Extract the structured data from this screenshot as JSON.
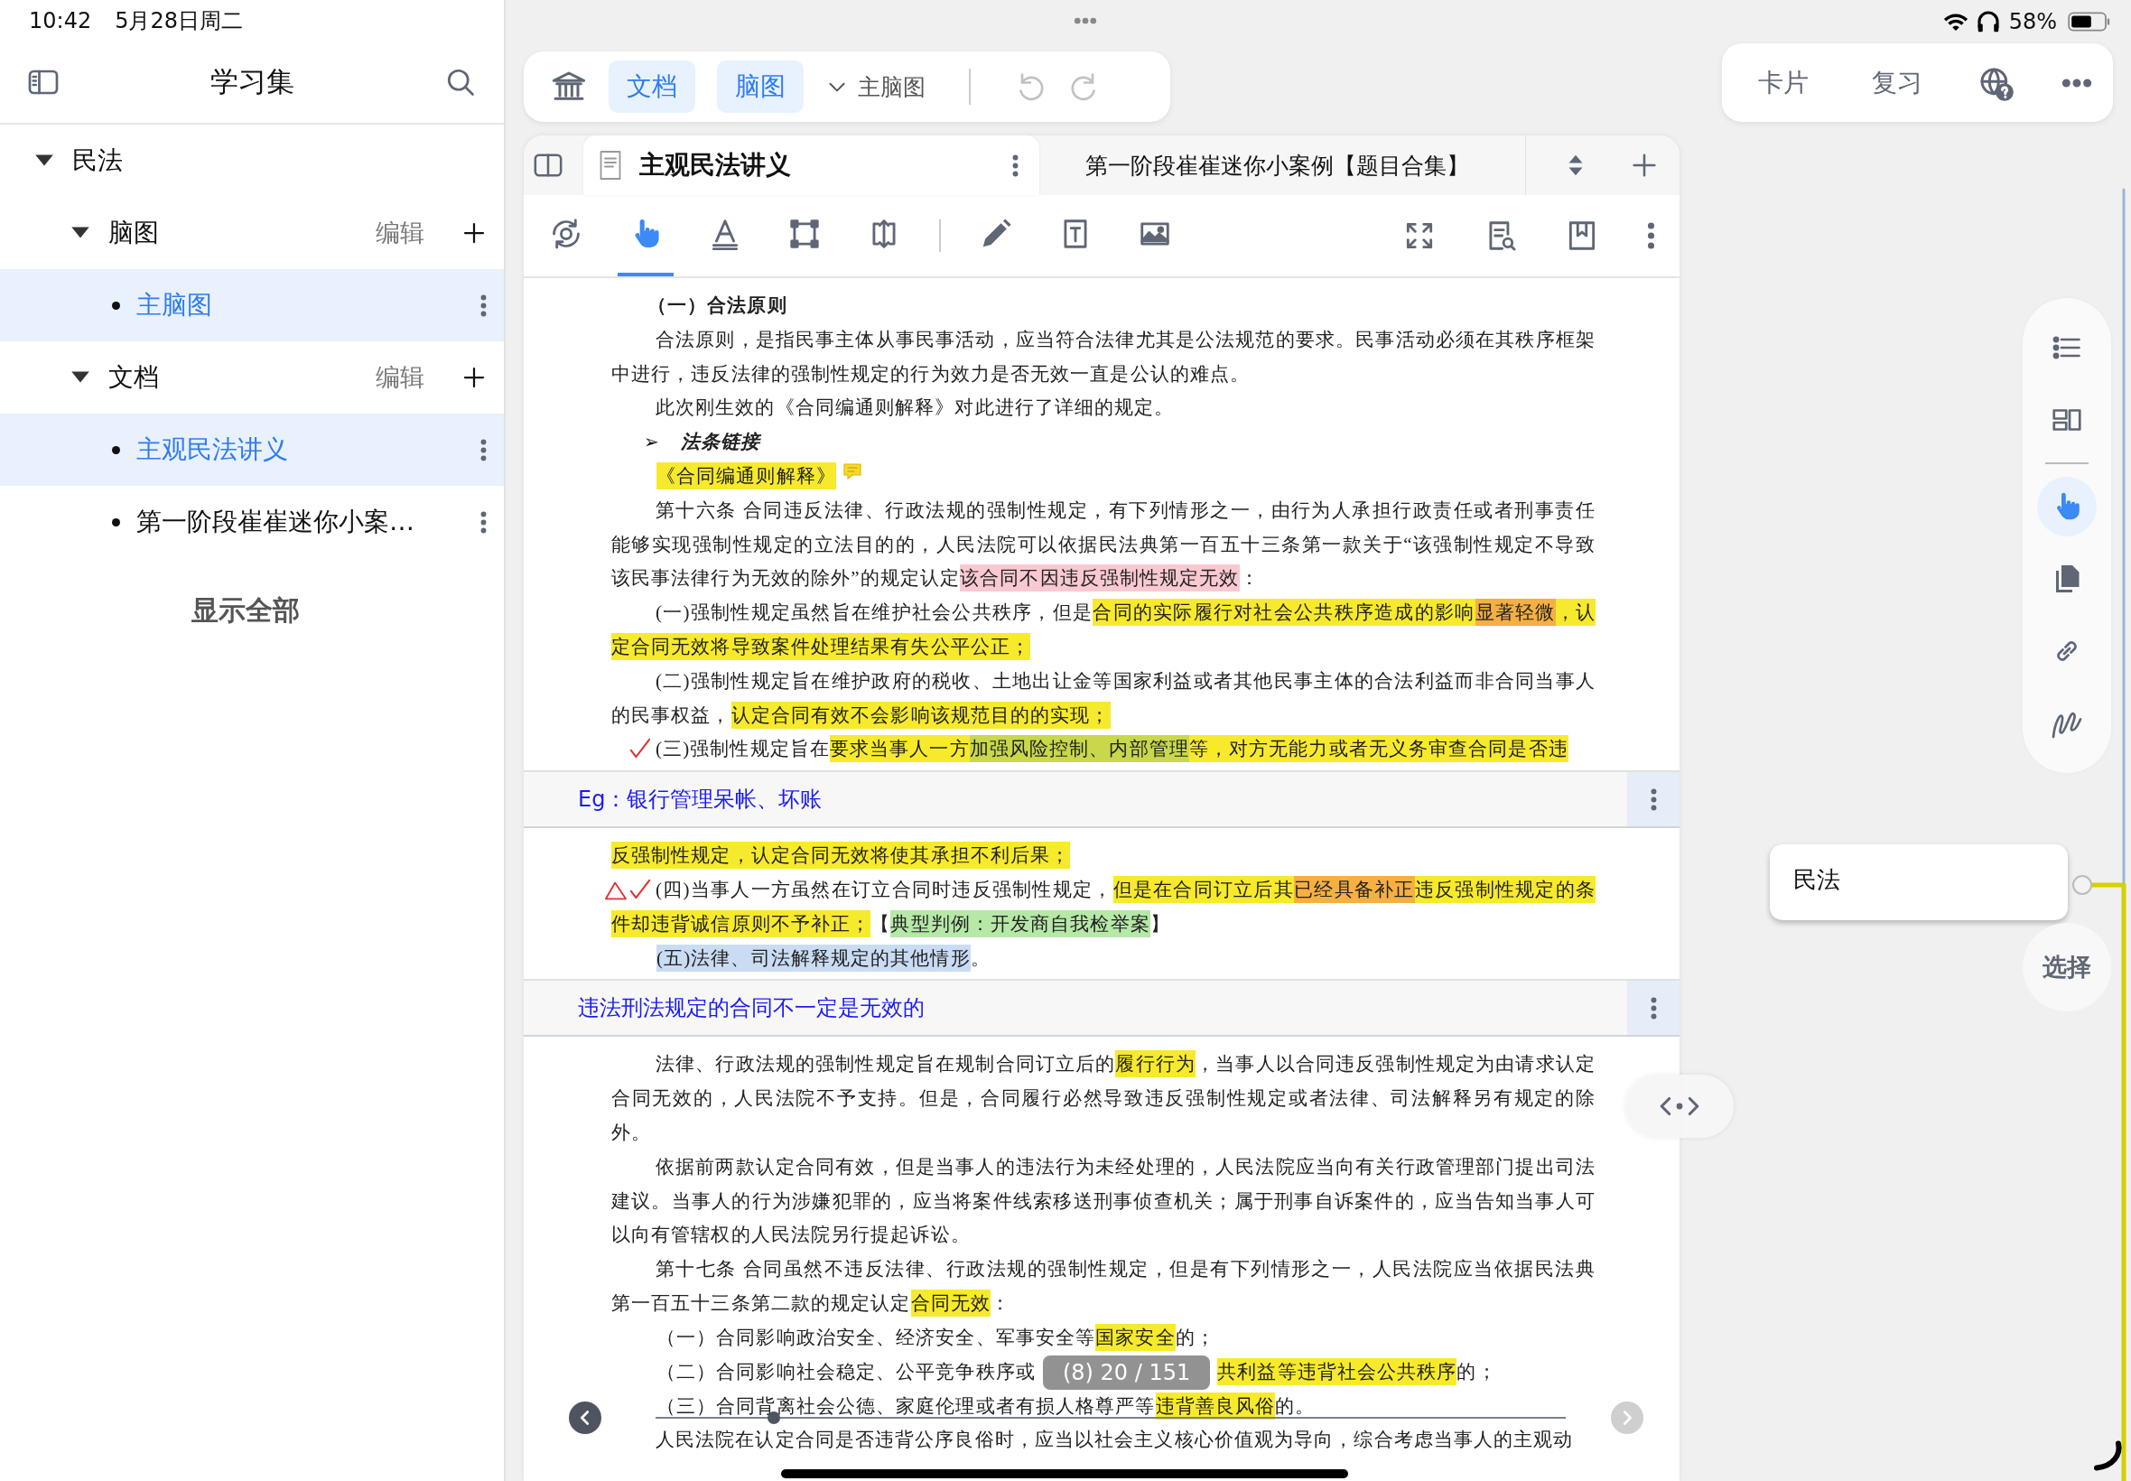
{
  "status": {
    "time": "10:42",
    "date": "5月28日周二",
    "battery": "58%"
  },
  "sidebar": {
    "title": "学习集",
    "tree": [
      {
        "label": "民法",
        "expanded": true,
        "children": [
          {
            "label": "脑图",
            "expanded": true,
            "action": "编辑",
            "children": [
              {
                "label": "主脑图",
                "selected": true
              }
            ]
          },
          {
            "label": "文档",
            "expanded": true,
            "action": "编辑",
            "children": [
              {
                "label": "主观民法讲义",
                "selected": true
              },
              {
                "label": "第一阶段崔崔迷你小案…",
                "selected": false
              }
            ]
          }
        ]
      }
    ],
    "show_all": "显示全部"
  },
  "toolbar": {
    "views": [
      {
        "label": "文档",
        "selected": true
      },
      {
        "label": "脑图",
        "selected": true
      }
    ],
    "map_selector": "主脑图",
    "undo_disabled": true,
    "redo_disabled": true
  },
  "right_toolbar": {
    "buttons": [
      "卡片",
      "复习"
    ]
  },
  "doc": {
    "tabs": [
      {
        "title": "主观民法讲义",
        "selected": true
      },
      {
        "title": "第一阶段崔崔迷你小案例【题目合集】",
        "selected": false
      }
    ],
    "tools": [
      {
        "kind": "gear-cycle",
        "selected": false
      },
      {
        "kind": "hand",
        "selected": true
      },
      {
        "kind": "text-style",
        "selected": false
      },
      {
        "kind": "select-rect",
        "selected": false
      },
      {
        "kind": "resize",
        "selected": false
      },
      {
        "kind": "pencil",
        "selected": false
      },
      {
        "kind": "text-box",
        "selected": false
      },
      {
        "kind": "image",
        "selected": false
      }
    ],
    "sections": [
      {
        "kind": "page",
        "paragraphs": [
          {
            "kind": "heading",
            "segs": [
              "（一）合法原则"
            ]
          },
          {
            "kind": "para",
            "segs": [
              "合法原则，是指民事主体从事民事活动，应当符合法律尤其是公法规范的要求。民事活动必须在其秩序框架中进行，违反法律的强制性规定的行为效力是否无效一直是公认的难点。"
            ]
          },
          {
            "kind": "para",
            "segs": [
              "此次刚生效的《合同编通则解释》对此进行了详细的规定。"
            ]
          },
          {
            "kind": "bullet",
            "bullet": "➢",
            "segs": [
              "法条链接"
            ]
          },
          {
            "kind": "item",
            "note": true,
            "segs": [
              {
                "text": "《合同编通则解释》",
                "color": "#f7ea2c"
              }
            ]
          },
          {
            "kind": "para",
            "segs": [
              "第十六条  合同违反法律、行政法规的强制性规定，有下列情形之一，由行为人承担行政责任或者刑事责任能够实现强制性规定的立法目的的，人民法院可以依据民法典第一百五十三条第一款关于“该强制性规定不导致该民事法律行为无效的除外”的规定认定",
              {
                "text": "该合同不因违反强制性规定无效",
                "color": "#f9c9d2"
              },
              "："
            ]
          },
          {
            "kind": "para",
            "segs": [
              "(一)强制性规定虽然旨在维护社会公共秩序，但是",
              {
                "text": "合同的实际履行对社会公共秩序造成的影响",
                "color": "#f7ea2c"
              },
              {
                "text": "显著轻微",
                "color": "#f5b041"
              },
              {
                "text": "，认定合同无效将导致案件处理结果有失公平公正；",
                "color": "#f7ea2c"
              }
            ]
          },
          {
            "kind": "para",
            "segs": [
              "(二)强制性规定旨在维护政府的税收、土地出让金等国家利益或者其他民事主体的合法利益而非合同当事人的民事权益，",
              {
                "text": "认定合同有效不会影响该规范目的的实现；",
                "color": "#f7ea2c"
              }
            ]
          },
          {
            "kind": "para",
            "checkmark": true,
            "segs": [
              "(三)强制性规定旨在",
              {
                "text": "要求当事人一方",
                "color": "#f7ea2c"
              },
              {
                "text": "加强风险控制、内部管理",
                "color": "#c8d84a"
              },
              {
                "text": "等，对方无能力或者无义务审查合同是否违",
                "color": "#f7ea2c"
              }
            ]
          }
        ]
      },
      {
        "kind": "note",
        "text": "Eg：银行管理呆帐、坏账"
      },
      {
        "kind": "page",
        "paragraphs": [
          {
            "kind": "cont",
            "segs": [
              {
                "text": "反强制性规定，认定合同无效将使其承担不利后果；",
                "color": "#f7ea2c"
              }
            ]
          },
          {
            "kind": "para",
            "checkmark": true,
            "triangle": true,
            "segs": [
              "(四)当事人一方虽然在订立合同时违反强制性规定，",
              {
                "text": "但是在合同订立后其",
                "color": "#f7ea2c"
              },
              {
                "text": "已经具备补正",
                "color": "#f5b041"
              },
              {
                "text": "违反强制性规定的条件却违背诚信原则不予补正；",
                "color": "#f7ea2c"
              },
              "【",
              {
                "text": "典型判例：开发商自我检举案",
                "color": "#b6e8a8"
              },
              "】"
            ]
          },
          {
            "kind": "item",
            "segs": [
              {
                "text": "(五)法律、司法解释规定的其他情形",
                "color": "#c9dcf4"
              },
              "。"
            ]
          }
        ]
      },
      {
        "kind": "note",
        "text": "违法刑法规定的合同不一定是无效的"
      },
      {
        "kind": "page",
        "paragraphs": [
          {
            "kind": "para",
            "segs": [
              "法律、行政法规的强制性规定旨在规制合同订立后的",
              {
                "text": "履行行为",
                "color": "#f7ea2c"
              },
              "，当事人以合同违反强制性规定为由请求认定合同无效的，人民法院不予支持。但是，合同履行必然导致违反强制性规定或者法律、司法解释另有规定的除外。"
            ]
          },
          {
            "kind": "para",
            "segs": [
              "依据前两款认定合同有效，但是当事人的违法行为未经处理的，人民法院应当向有关行政管理部门提出司法建议。当事人的行为涉嫌犯罪的，应当将案件线索移送刑事侦查机关；属于刑事自诉案件的，应当告知当事人可以向有管辖权的人民法院另行提起诉讼。"
            ]
          },
          {
            "kind": "para",
            "segs": [
              "第十七条  合同虽然不违反法律、行政法规的强制性规定，但是有下列情形之一，人民法院应当依据民法典第一百五十三条第二款的规定认定",
              {
                "text": "合同无效",
                "color": "#f7ea2c"
              },
              "："
            ]
          },
          {
            "kind": "item",
            "segs": [
              "（一）合同影响政治安全、经济安全、军事安全等",
              {
                "text": "国家安全",
                "color": "#f7ea2c"
              },
              "的；"
            ]
          },
          {
            "kind": "item",
            "covered": true,
            "segs": [
              "（二）合同影响社会稳定、公平竞争秩序或",
              {
                "text": "共利益等违背社会公共秩序",
                "color": "#f7ea2c"
              },
              "的；"
            ]
          },
          {
            "kind": "item",
            "segs": [
              "（三）合同背离社会公德、家庭伦理或者有损人格尊严等",
              {
                "text": "违背善良风俗",
                "color": "#f7ea2c"
              },
              "的。"
            ]
          },
          {
            "kind": "partial",
            "segs": [
              "人民法院在认定合同是否违背公序良俗时，应当以社会主义核心价值观为导向，综合考虑当事人的主观动"
            ]
          }
        ]
      }
    ],
    "pager": {
      "indicator": "(8) 20 / 151",
      "level": 0.13
    }
  },
  "side_tools": [
    {
      "kind": "list",
      "selected": false
    },
    {
      "kind": "layout",
      "selected": false
    },
    {
      "kind": "hand",
      "selected": true
    },
    {
      "kind": "copy",
      "selected": false
    },
    {
      "kind": "link",
      "selected": false
    },
    {
      "kind": "squiggle",
      "selected": false
    }
  ],
  "mindmap": {
    "node": "民法",
    "select_button": "选择"
  }
}
